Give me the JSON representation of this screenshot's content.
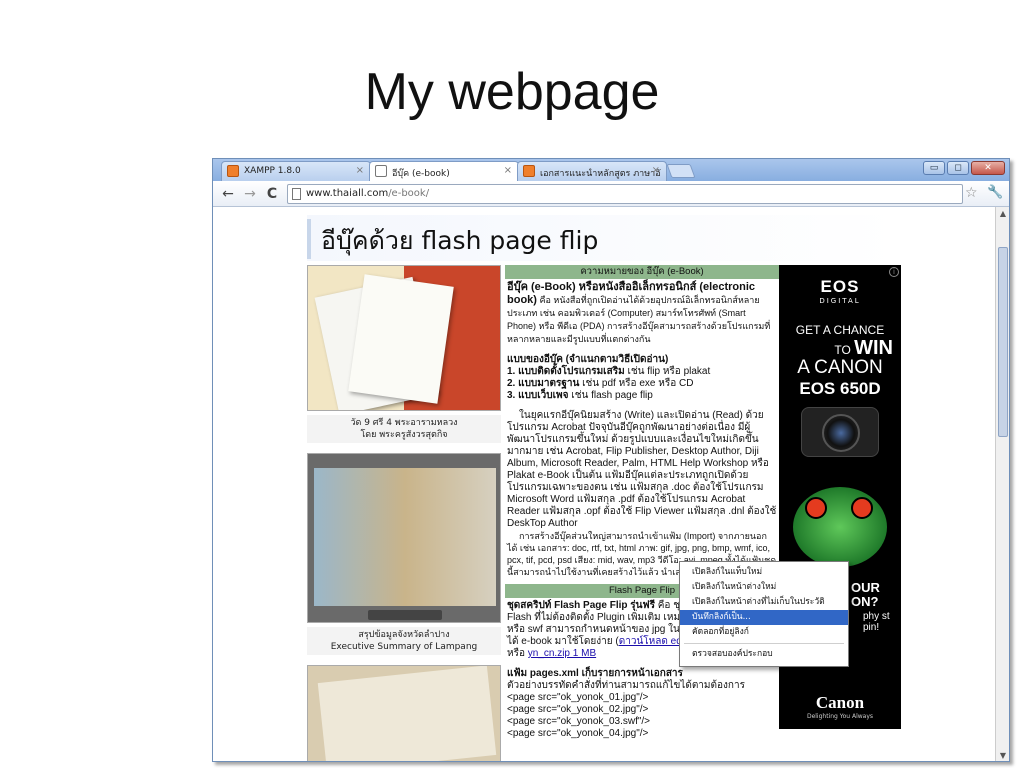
{
  "slide": {
    "title": "My webpage"
  },
  "browser": {
    "tabs": [
      {
        "label": "XAMPP 1.8.0",
        "icon": "xampp-icon",
        "active": false
      },
      {
        "label": "อีบุ๊ค (e-book)",
        "icon": "page-icon",
        "active": true
      },
      {
        "label": "เอกสารแนะนำหลักสูตร ภาษาอั",
        "icon": "xampp-icon",
        "active": false
      }
    ],
    "tab_close_glyph": "×",
    "window_buttons": {
      "minimize": "▭",
      "maximize": "◻",
      "close": "✕"
    },
    "nav": {
      "back": "←",
      "forward": "→",
      "reload": "C"
    },
    "url": {
      "host": "www.thaiall.com",
      "path": "/e-book/"
    },
    "star_glyph": "☆",
    "wrench_glyph": "🔧"
  },
  "page": {
    "heading": "อีบุ๊คด้วย flash page flip",
    "left": {
      "caption1_line1": "วัด 9 ศรี 4 พระอารามหลวง",
      "caption1_line2": "โดย พระครูสังวรสุตกิจ",
      "caption2_line1": "สรุปข้อมูลจังหวัดลำปาง",
      "caption2_line2": "Executive Summary of Lampang"
    },
    "middle": {
      "band1": "ความหมายของ อีบุ๊ค (e-Book)",
      "def_bold": "อีบุ๊ค (e-Book) หรือหนังสืออิเล็กทรอนิกส์ (electronic book)",
      "def_text": " คือ หนังสือที่ถูกเปิดอ่านได้ด้วยอุปกรณ์อิเล็กทรอนิกส์หลายประเภท เช่น คอมพิวเตอร์ (Computer) สมาร์ทโทรศัพท์ (Smart Phone) หรือ พีดีเอ (PDA) การสร้างอีบุ๊คสามารถสร้างด้วยโปรแกรมที่หลากหลายและมีรูปแบบที่แตกต่างกัน",
      "types_title": "แบบของอีบุ๊ค (จำแนกตามวิธีเปิดอ่าน)",
      "type1_bold": "1. แบบติดตั้งโปรแกรมเสริม",
      "type1_text": " เช่น flip หรือ plakat",
      "type2_bold": "2. แบบมาตรฐาน",
      "type2_text": " เช่น pdf หรือ exe หรือ CD",
      "type3_bold": "3. แบบเว็บเพจ",
      "type3_text": " เช่น flash page flip",
      "para1": "ในยุคแรกอีบุ๊คนิยมสร้าง (Write) และเปิดอ่าน (Read) ด้วยโปรแกรม Acrobat ปัจจุบันอีบุ๊คถูกพัฒนาอย่างต่อเนื่อง มีผู้พัฒนาโปรแกรมขึ้นใหม่ ด้วยรูปแบบและเงื่อนไขใหม่เกิดขึ้นมากมาย เช่น Acrobat, Flip Publisher, Desktop Author, Diji Album, Microsoft Reader, Palm, HTML Help Workshop หรือ Plakat e-Book เป็นต้น แฟ้มอีบุ๊คแต่ละประเภทถูกเปิดด้วยโปรแกรมเฉพาะของตน เช่น แฟ้มสกุล .doc ต้องใช้โปรแกรม Microsoft Word แฟ้มสกุล .pdf ต้องใช้โปรแกรม Acrobat Reader แฟ้มสกุล .opf ต้องใช้ Flip Viewer แฟ้มสกุล .dnl ต้องใช้ DeskTop Author",
      "para2": "การสร้างอีบุ๊คส่วนใหญ่สามารถนำเข้าแฟ้ม (Import) จากภายนอกได้ เช่น เอกสาร: doc, rtf, txt, html ภาพ: gif, jpg, png, bmp, wmf, ico, pcx, tif, pcd, psd เสียง: mid, wav, mp3 วีดีโอ: avi, mpeg ทั้งได้แฟ้มชุดนี้สามารถนำไปใช้งานที่เคยสร้างไว้แล้ว นำเสนอผ่านอีบุ๊คได้โดยง่าย",
      "band2": "Flash Page Flip",
      "script_bold": "ชุดสคริปท์ Flash Page Flip รุ่นฟรี",
      "script_text": " คือ ชุดสคริปท์ที่พัฒนาด้วย Flash ที่ไม่ต้องติดตั้ง Plugin เพิ่มเติม เหมาะกับผู้ที่มีแฟ้ม jpg หรือ swf สามารถกำหนดหน้าของ jpg ในแฟ้ม Pages.xml ก็จะได้ e-book มาใช้โดยง่าย (",
      "link1": "ดาวน์โหลด eduzones.zip 6 MB",
      "link_or": ") หรือ ",
      "link2": "yn_cn.zip 1 MB",
      "xml_title": "แฟ้ม pages.xml เก็บรายการหน้าเอกสาร",
      "xml_desc": "ตัวอย่างบรรทัดคำสั่งที่ท่านสามารถแก้ไขได้ตามต้องการ",
      "xml_lines": [
        "<page src=\"ok_yonok_01.jpg\"/>",
        "<page src=\"ok_yonok_02.jpg\"/>",
        "<page src=\"ok_yonok_03.swf\"/>",
        "<page src=\"ok_yonok_04.jpg\"/>"
      ]
    },
    "ad": {
      "info_glyph": "i",
      "brand": "EOS",
      "brand_sub": "DIGITAL",
      "chance": "GET A CHANCE",
      "to": "TO ",
      "win": "WIN",
      "a_canon": "A CANON",
      "model": "EOS 650D",
      "partial_big": "OUR ON?",
      "partial_small": "phy st pin!",
      "logo": "Canon",
      "tagline": "Delighting You Always"
    },
    "context_menu": [
      "เปิดลิงก์ในแท็บใหม่",
      "เปิดลิงก์ในหน้าต่างใหม่",
      "เปิดลิงก์ในหน้าต่างที่ไม่เก็บในประวัติ",
      "บันทึกลิงก์เป็น...",
      "คัดลอกที่อยู่ลิงก์",
      "ตรวจสอบองค์ประกอบ"
    ],
    "context_menu_highlight": 3
  },
  "scrollbar": {
    "up": "▲",
    "down": "▼"
  }
}
